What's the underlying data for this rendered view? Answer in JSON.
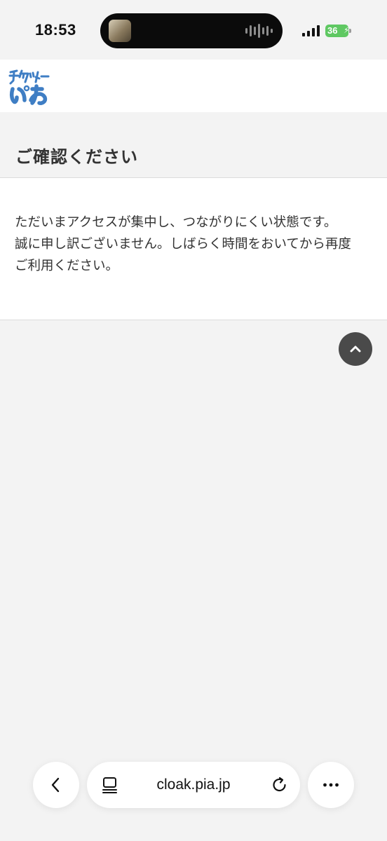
{
  "status_bar": {
    "time": "18:53",
    "battery_level": "36"
  },
  "site": {
    "logo": {
      "text_line1": "チケット",
      "text_line2": "ぴあ",
      "color": "#3f7ec4"
    }
  },
  "page": {
    "title": "ご確認ください",
    "message_lines": [
      "ただいまアクセスが集中し、つながりにくい状態です。",
      "誠に申し訳ございません。しばらく時間をおいてから再度",
      "ご利用ください。"
    ]
  },
  "scroll_top": {
    "icon": "chevron-up-icon"
  },
  "browser": {
    "url": "cloak.pia.jp",
    "back_icon": "chevron-left-icon",
    "reader_icon": "page-menu-icon",
    "reload_icon": "reload-icon",
    "more_icon": "ellipsis-icon"
  }
}
